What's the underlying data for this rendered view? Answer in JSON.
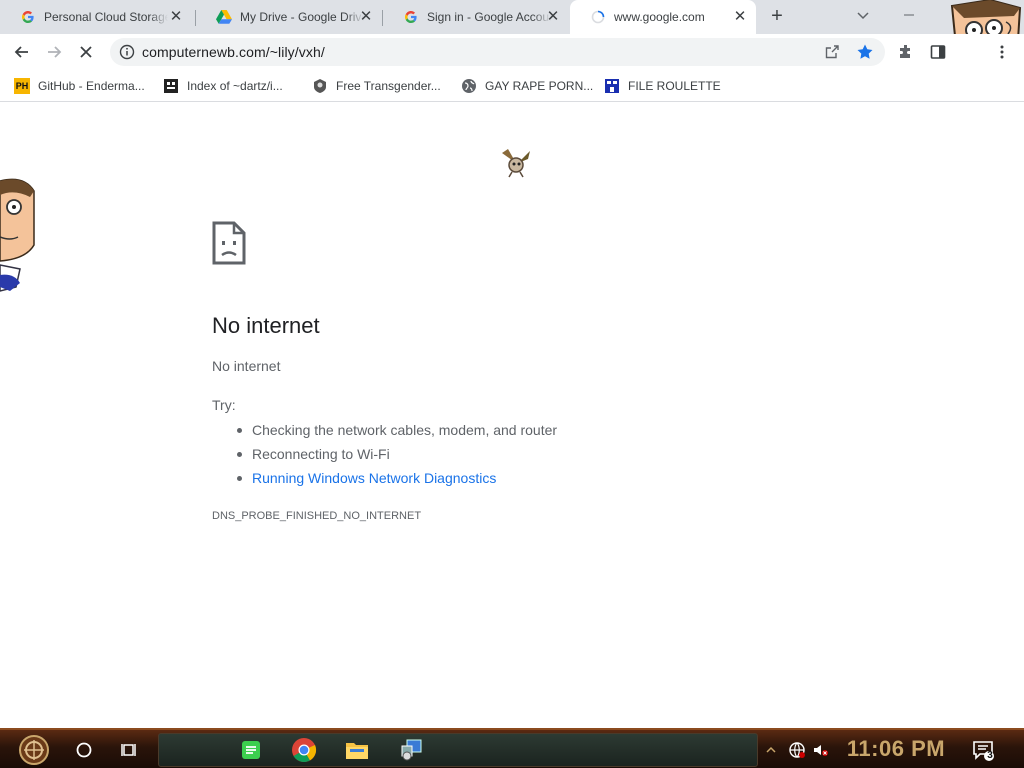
{
  "browser": {
    "tabs": [
      {
        "title": "Personal Cloud Storage",
        "favicon": "google-g-icon"
      },
      {
        "title": "My Drive - Google Drive",
        "favicon": "google-drive-icon"
      },
      {
        "title": "Sign in - Google Accounts",
        "favicon": "google-g-icon"
      },
      {
        "title": "www.google.com",
        "favicon": "loading-spinner-icon"
      }
    ],
    "url": "computernewb.com/~lily/vxh/",
    "bookmarks": [
      {
        "label": "GitHub - Enderma...",
        "icon": "ph-badge-icon"
      },
      {
        "label": "Index of ~dartz/i...",
        "icon": "bug-icon"
      },
      {
        "label": "Free Transgender...",
        "icon": "site-icon"
      },
      {
        "label": "GAY RAPE PORN...",
        "icon": "globe-icon"
      },
      {
        "label": "FILE ROULETTE",
        "icon": "file-icon"
      }
    ]
  },
  "error_page": {
    "title": "No internet",
    "subtitle": "No internet",
    "try_label": "Try:",
    "suggestions": [
      "Checking the network cables, modem, and router",
      "Reconnecting to Wi-Fi",
      "Running Windows Network Diagnostics"
    ],
    "error_code": "DNS_PROBE_FINISHED_NO_INTERNET"
  },
  "taskbar": {
    "clock": "11:06 PM",
    "notification_count": "3"
  },
  "colors": {
    "tabstrip": "#dee1e6",
    "link": "#1a73e8",
    "bookmark_star": "#1a73e8",
    "taskbar_clock": "#c9a66b"
  }
}
